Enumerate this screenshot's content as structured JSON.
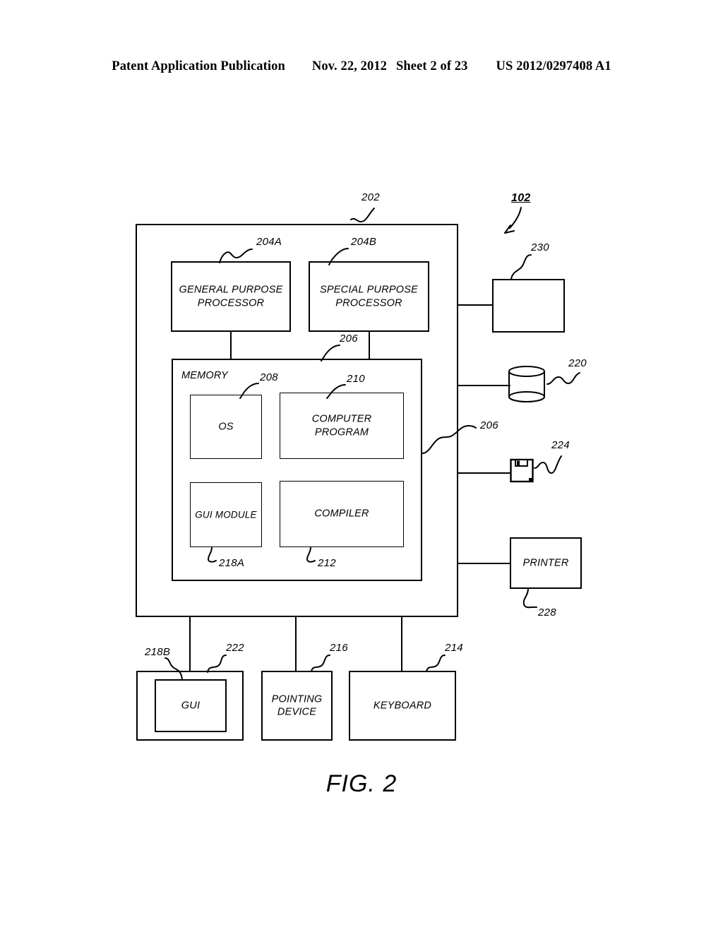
{
  "header": {
    "publication": "Patent Application Publication",
    "date": "Nov. 22, 2012",
    "sheet": "Sheet 2 of 23",
    "number": "US 2012/0297408 A1"
  },
  "figure": {
    "caption": "FIG. 2",
    "system_ref": "102",
    "blocks": {
      "computer": {
        "label": "",
        "ref": "202"
      },
      "general_purpose_processor": {
        "label": "GENERAL PURPOSE\nPROCESSOR",
        "ref": "204A"
      },
      "special_purpose_processor": {
        "label": "SPECIAL PURPOSE\nPROCESSOR",
        "ref": "204B"
      },
      "memory": {
        "label": "MEMORY",
        "ref": "206"
      },
      "memory_bus": {
        "ref": "206"
      },
      "os": {
        "label": "OS",
        "ref": "208"
      },
      "computer_program": {
        "label": "COMPUTER\nPROGRAM",
        "ref": "210"
      },
      "gui_module": {
        "label": "GUI MODULE",
        "ref": "218A"
      },
      "compiler": {
        "label": "COMPILER",
        "ref": "212"
      },
      "unlabeled_device": {
        "label": "",
        "ref": "230"
      },
      "data_storage": {
        "label": "",
        "ref": "220"
      },
      "removable_media": {
        "label": "",
        "ref": "224"
      },
      "printer": {
        "label": "PRINTER",
        "ref": "228"
      },
      "display": {
        "label": "",
        "ref": "222"
      },
      "gui": {
        "label": "GUI",
        "ref": "218B"
      },
      "pointing_device": {
        "label": "POINTING\nDEVICE",
        "ref": "216"
      },
      "keyboard": {
        "label": "KEYBOARD",
        "ref": "214"
      }
    },
    "icons": {
      "data_storage": "cylinder-database-icon",
      "removable_media": "floppy-disk-icon",
      "system_pointer": "arrow-icon"
    }
  }
}
